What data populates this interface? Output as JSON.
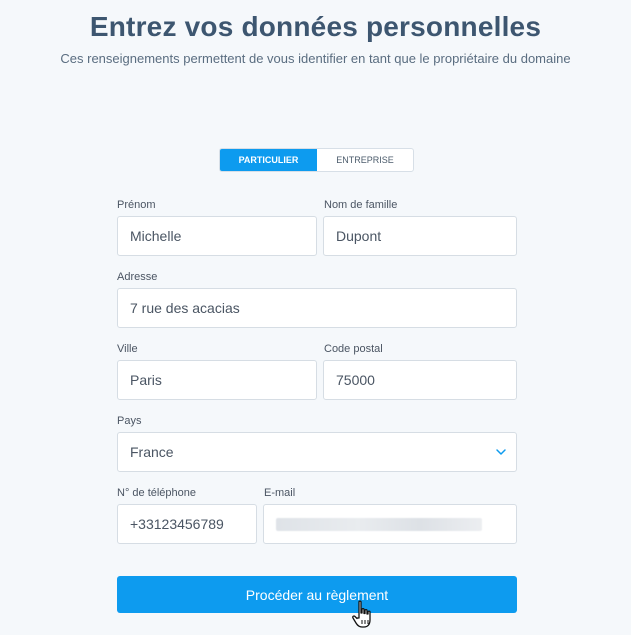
{
  "header": {
    "title": "Entrez vos données personnelles",
    "subtitle": "Ces renseignements permettent de vous identifier en tant que le propriétaire du domaine"
  },
  "account_type": {
    "options": [
      "PARTICULIER",
      "ENTREPRISE"
    ],
    "selected": "PARTICULIER"
  },
  "form": {
    "first_name": {
      "label": "Prénom",
      "value": "Michelle"
    },
    "last_name": {
      "label": "Nom de famille",
      "value": "Dupont"
    },
    "address": {
      "label": "Adresse",
      "value": "7 rue des acacias"
    },
    "city": {
      "label": "Ville",
      "value": "Paris"
    },
    "postal_code": {
      "label": "Code postal",
      "value": "75000"
    },
    "country": {
      "label": "Pays",
      "value": "France"
    },
    "phone": {
      "label": "N° de téléphone",
      "value": "+33123456789"
    },
    "email": {
      "label": "E-mail",
      "value": ""
    }
  },
  "submit_label": "Procéder au règlement",
  "colors": {
    "accent": "#0d9bef",
    "title": "#3d5670",
    "background": "#f5f8fb"
  },
  "icons": {
    "country_select": "chevron-down-icon",
    "cursor": "hand-pointer-icon"
  }
}
